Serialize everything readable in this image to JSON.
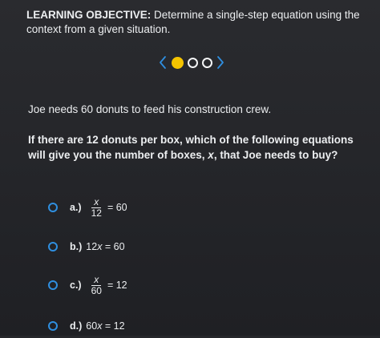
{
  "objective": {
    "label": "LEARNING OBJECTIVE:",
    "text": " Determine a single-step equation using the context from a given situation."
  },
  "pager": {
    "prev_glyph": "<",
    "next_glyph": ">",
    "dot_count": 3,
    "active_index": 0
  },
  "question": {
    "intro": "Joe needs 60 donuts to feed his construction crew.",
    "prompt_part1": "If there are 12 donuts per box, which of the following equations will give you the number of boxes, ",
    "prompt_var": "x",
    "prompt_part2": ", that Joe needs to buy?"
  },
  "choices": {
    "a": {
      "letter": "a.)",
      "numerator": "x",
      "denominator": "12",
      "rhs": "= 60"
    },
    "b": {
      "letter": "b.)",
      "coef": "12",
      "var": "x",
      "rhs": " = 60"
    },
    "c": {
      "letter": "c.)",
      "numerator": "x",
      "denominator": "60",
      "rhs": "= 12"
    },
    "d": {
      "letter": "d.)",
      "coef": "60",
      "var": "x",
      "rhs": " = 12"
    }
  },
  "colors": {
    "background": "#26272b",
    "text": "#eceef0",
    "radio": "#2f8fe0",
    "active_dot": "#f5c400"
  }
}
